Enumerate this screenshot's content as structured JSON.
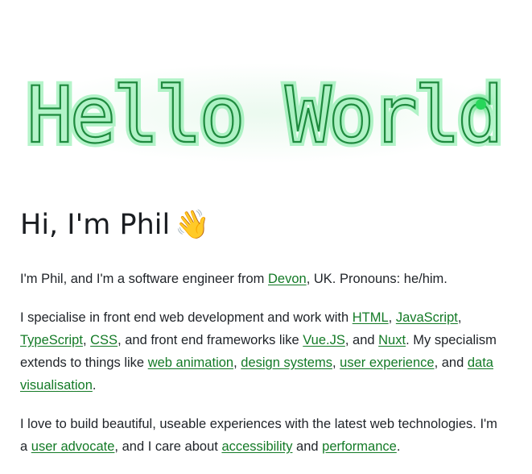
{
  "banner": {
    "text": "Hello World"
  },
  "heading": {
    "text": "Hi, I'm Phil",
    "emoji": "👋"
  },
  "paragraphs": {
    "p1": {
      "t1": "I'm Phil, and I'm a software engineer from ",
      "link_devon": "Devon",
      "t2": ", UK. Pronouns: he/him."
    },
    "p2": {
      "t1": "I specialise in front end web development and work with ",
      "link_html": "HTML",
      "t2": ", ",
      "link_javascript": "JavaScript",
      "t3": ", ",
      "link_typescript": "TypeScript",
      "t4": ", ",
      "link_css": "CSS",
      "t5": ", and front end frameworks like ",
      "link_vue": "Vue.JS",
      "t6": ", and ",
      "link_nuxt": "Nuxt",
      "t7": ". My specialism extends to things like ",
      "link_web_animation": "web animation",
      "t8": ", ",
      "link_design_systems": "design systems",
      "t9": ", ",
      "link_user_experience": "user experience",
      "t10": ", and ",
      "link_data_visualisation": "data visualisation",
      "t11": "."
    },
    "p3": {
      "t1": "I love to build beautiful, useable experiences with the latest web technologies. I'm a ",
      "link_user_advocate": "user advocate",
      "t2": ", and I care about ",
      "link_accessibility": "accessibility",
      "t3": " and ",
      "link_performance": "performance",
      "t4": "."
    }
  },
  "colors": {
    "link": "#137a26",
    "neon_stroke": "#1e8a3e",
    "neon_glow": "#2ee06a",
    "text": "#1f2328"
  }
}
